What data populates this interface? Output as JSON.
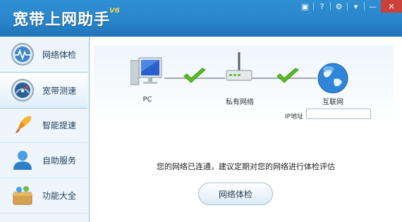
{
  "app": {
    "title": "宽带上网助手",
    "version": "V6"
  },
  "window_controls": [
    {
      "name": "skin-icon",
      "glyph": "▣"
    },
    {
      "name": "help-icon",
      "glyph": "?"
    },
    {
      "name": "settings-icon",
      "glyph": "⚙"
    },
    {
      "name": "menu-icon",
      "glyph": "▾"
    },
    {
      "name": "minimize-icon",
      "glyph": "—"
    },
    {
      "name": "close-icon",
      "glyph": "✕"
    }
  ],
  "sidebar": {
    "items": [
      {
        "label": "网络体检",
        "icon": "heartbeat-icon",
        "active": false
      },
      {
        "label": "宽带测速",
        "icon": "speedometer-icon",
        "active": true
      },
      {
        "label": "智能提速",
        "icon": "rocket-icon",
        "active": false
      },
      {
        "label": "自助服务",
        "icon": "user-icon",
        "active": false
      },
      {
        "label": "功能大全",
        "icon": "toolbox-icon",
        "active": false
      }
    ]
  },
  "topology": {
    "nodes": [
      {
        "label": "PC",
        "icon": "pc-icon"
      },
      {
        "label": "私有网络",
        "icon": "router-icon"
      },
      {
        "label": "互联网",
        "icon": "globe-icon"
      }
    ],
    "links": [
      {
        "status": "ok",
        "icon": "check-icon"
      },
      {
        "status": "ok",
        "icon": "check-icon"
      }
    ]
  },
  "ip": {
    "label": "IP地址",
    "value": ""
  },
  "status_message": "您的网络已连通，建议定期对您的网络进行体检评估",
  "actions": {
    "check_button": "网络体检"
  },
  "colors": {
    "titlebar": "#2a86cc",
    "accent_green": "#5bbf1e",
    "close": "#c9413b"
  }
}
